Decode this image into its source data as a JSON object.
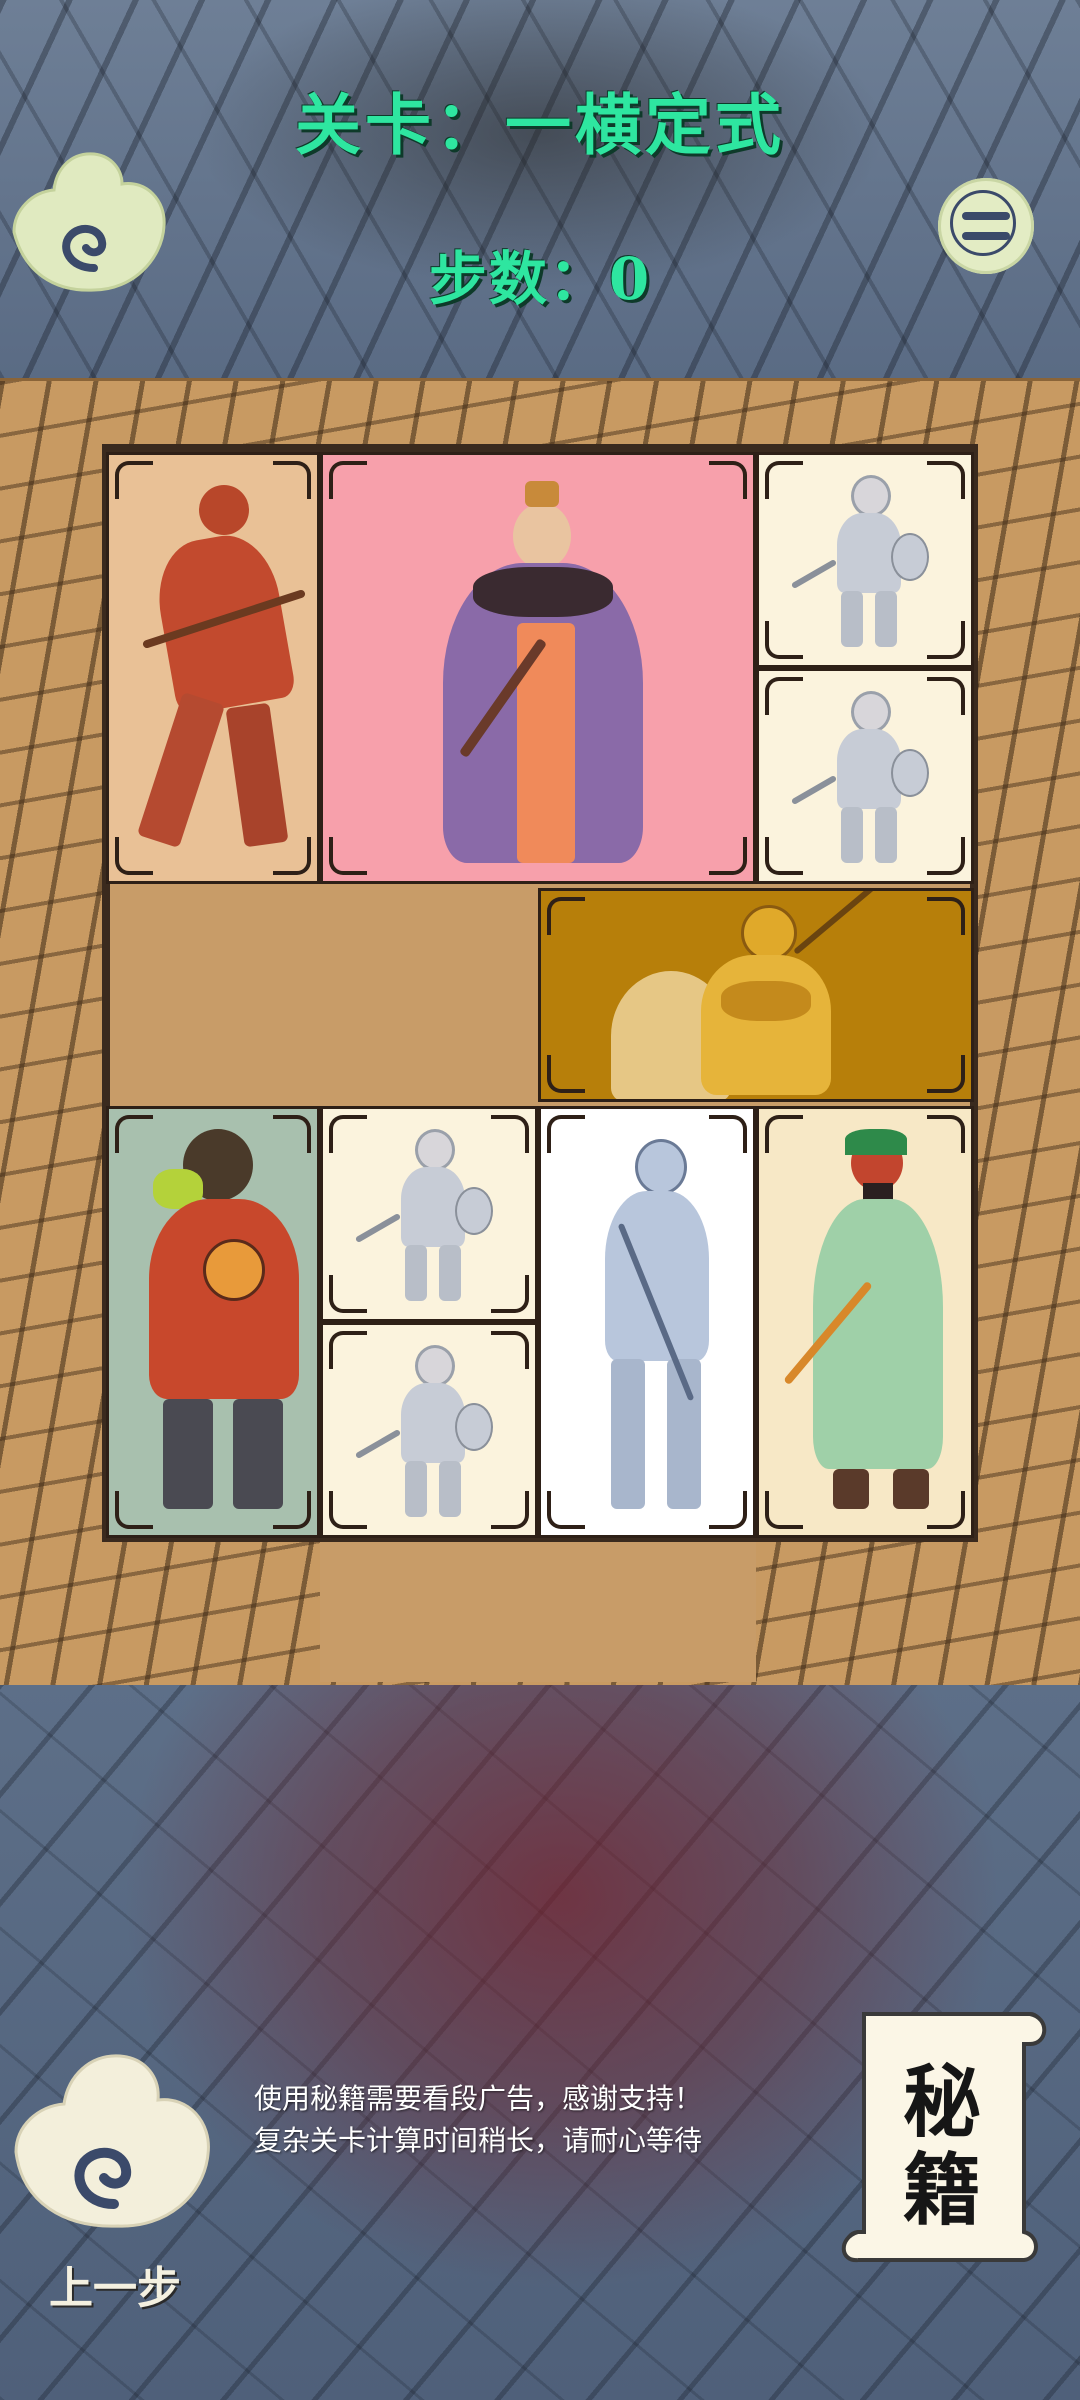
{
  "header": {
    "level_title": "关卡：一横定式",
    "step_count": "步数：0"
  },
  "icons": {
    "back": "cloud-swirl-back-icon",
    "menu": "circle-menu-icon",
    "undo": "cloud-swirl-undo-icon",
    "secret": "scroll-icon"
  },
  "board": {
    "pieces": [
      {
        "name": "general-red-armor",
        "description": "red armored warrior"
      },
      {
        "name": "cao-cao",
        "description": "robed lord"
      },
      {
        "name": "soldier-1"
      },
      {
        "name": "soldier-2"
      },
      {
        "name": "general-gold-armor"
      },
      {
        "name": "zhang-fei"
      },
      {
        "name": "soldier-3"
      },
      {
        "name": "soldier-4"
      },
      {
        "name": "zhao-yun"
      },
      {
        "name": "guan-yu"
      }
    ]
  },
  "footer": {
    "hint_line_1": "使用秘籍需要看段广告，感谢支持！",
    "hint_line_2": "复杂关卡计算时间稍长，请耐心等待",
    "undo_label": "上一步",
    "secret_label_1": "秘",
    "secret_label_2": "籍"
  },
  "colors": {
    "title_green": "#2ee6a0",
    "board_tan": "#c89c68",
    "cao_cao_bg": "#f7a0ab",
    "gold_bg": "#b77f0a",
    "soldier_bg": "#fbf3dd"
  }
}
